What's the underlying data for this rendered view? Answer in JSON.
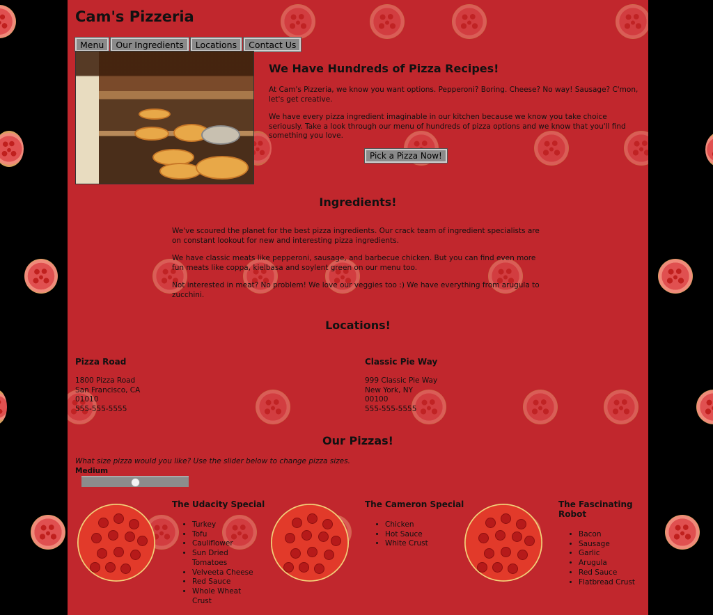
{
  "header": {
    "title": "Cam's Pizzeria"
  },
  "nav": [
    {
      "label": "Menu"
    },
    {
      "label": "Our Ingredients"
    },
    {
      "label": "Locations"
    },
    {
      "label": "Contact Us"
    }
  ],
  "hero": {
    "heading": "We Have Hundreds of Pizza Recipes!",
    "p1": "At Cam's Pizzeria, we know you want options. Pepperoni? Boring. Cheese? No way! Sausage? C'mon, let's get creative.",
    "p2": "We have every pizza ingredient imaginable in our kitchen because we know you take choice seriously. Take a look through our menu of hundreds of pizza options and we know that you'll find something you love.",
    "cta": "Pick a Pizza Now!"
  },
  "ingredients": {
    "heading": "Ingredients!",
    "p1": "We've scoured the planet for the best pizza ingredients. Our crack team of ingredient specialists are on constant lookout for new and interesting pizza ingredients.",
    "p2": "We have classic meats like pepperoni, sausage, and barbecue chicken. But you can find even more fun meats like coppa, kielbasa and soylent green on our menu too.",
    "p3": "Not interested in meat? No problem! We love our veggies too :) We have everything from arugula to zucchini."
  },
  "locations": {
    "heading": "Locations!",
    "items": [
      {
        "name": "Pizza Road",
        "street": "1800 Pizza Road",
        "city": "San Francisco, CA",
        "zip": "01010",
        "phone": "555-555-5555"
      },
      {
        "name": "Classic Pie Way",
        "street": "999 Classic Pie Way",
        "city": "New York, NY",
        "zip": "00100",
        "phone": "555-555-5555"
      }
    ]
  },
  "pizzas": {
    "heading": "Our Pizzas!",
    "prompt": "What size pizza would you like? Use the slider below to change pizza sizes.",
    "size_label": "Medium",
    "slider_value": 0.5,
    "items": [
      {
        "name": "The Udacity Special",
        "ingredients": [
          "Turkey",
          "Tofu",
          "Cauliflower",
          "Sun Dried Tomatoes",
          "Velveeta Cheese",
          "Red Sauce",
          "Whole Wheat Crust"
        ]
      },
      {
        "name": "The Cameron Special",
        "ingredients": [
          "Chicken",
          "Hot Sauce",
          "White Crust"
        ]
      },
      {
        "name": "The Fascinating Robot",
        "ingredients": [
          "Bacon",
          "Sausage",
          "Garlic",
          "Arugula",
          "Red Sauce",
          "Flatbread Crust"
        ]
      }
    ]
  }
}
